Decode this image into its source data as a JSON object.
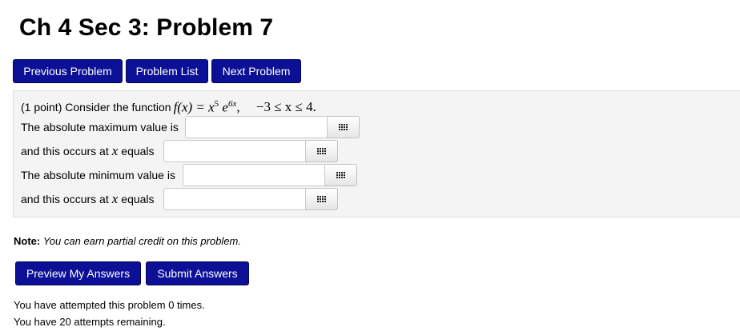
{
  "page": {
    "title": "Ch 4 Sec 3: Problem 7"
  },
  "nav": {
    "previous_label": "Previous Problem",
    "list_label": "Problem List",
    "next_label": "Next Problem"
  },
  "problem": {
    "points": "(1 point) Consider the function",
    "function_lhs": "f(x) = x",
    "exp1": "5",
    "base2": "e",
    "exp2": "6x",
    "comma": ",",
    "domain": "−3 ≤ x ≤ 4.",
    "q1_label": "The absolute maximum value is",
    "q2_prefix": "and this occurs at",
    "q2_var": "x",
    "q2_suffix": "equals",
    "q3_label": "The absolute minimum value is",
    "q4_prefix": "and this occurs at",
    "q4_var": "x",
    "q4_suffix": "equals",
    "answer1_value": "",
    "answer2_value": "",
    "answer3_value": "",
    "answer4_value": ""
  },
  "note": {
    "bold": "Note:",
    "text": "You can earn partial credit on this problem."
  },
  "actions": {
    "preview_label": "Preview My Answers",
    "submit_label": "Submit Answers"
  },
  "status": {
    "attempted": "You have attempted this problem 0 times.",
    "remaining": "You have 20 attempts remaining."
  },
  "colors": {
    "button_bg": "#0b1096",
    "panel_bg": "#f4f4f4"
  }
}
